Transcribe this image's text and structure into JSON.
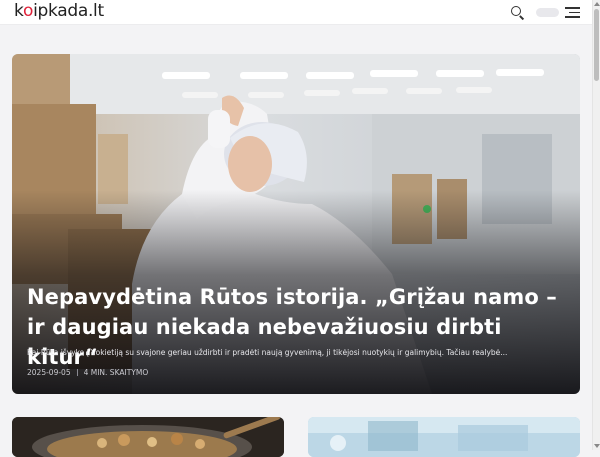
{
  "header": {
    "logo_parts": [
      "k",
      "o",
      "ipkada.lt"
    ],
    "logo_text": "koipkada.lt",
    "accent_color": "#e0223a",
    "icons": [
      "search-icon",
      "theme-toggle",
      "menu-icon"
    ]
  },
  "hero": {
    "title": "Nepavydėtina Rūtos istorija. „Grįžau namo – ir daugiau niekada nebevažiuosiu dirbti kitur“",
    "excerpt": "Kai Rūta išvyko į Vokietiją su svajone geriau uždirbti ir pradėti naują gyvenimą, ji tikėjosi nuotykių ir galimybių. Tačiau realybė...",
    "date": "2025-09-05",
    "read_time": "4 MIN. SKAITYMO"
  },
  "cards": [
    {
      "name": "card-food"
    },
    {
      "name": "card-lab"
    }
  ]
}
